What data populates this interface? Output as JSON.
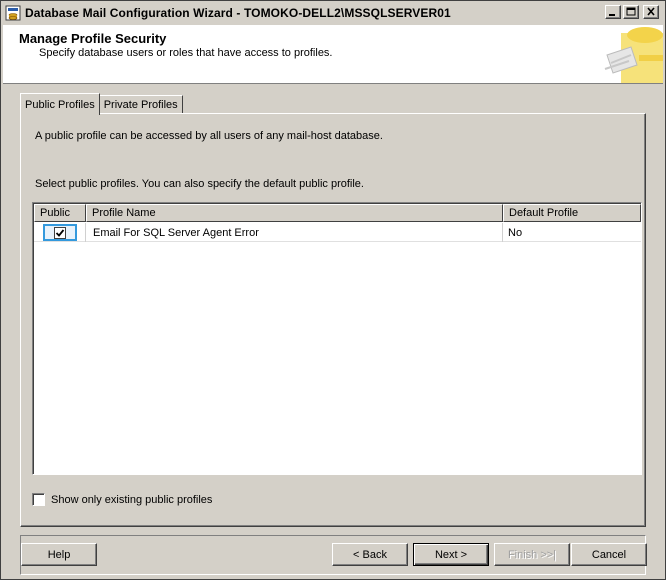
{
  "window": {
    "title": "Database Mail Configuration Wizard - TOMOKO-DELL2\\MSSQLSERVER01"
  },
  "header": {
    "title": "Manage Profile Security",
    "subtitle": "Specify database users or roles that have access to profiles."
  },
  "tabs": [
    {
      "label": "Public Profiles",
      "active": true
    },
    {
      "label": "Private Profiles",
      "active": false
    }
  ],
  "panel": {
    "description": "A public profile can be accessed by all users of any mail-host database.",
    "instruction": "Select public profiles. You can also specify the default public profile."
  },
  "grid": {
    "columns": [
      "Public",
      "Profile Name",
      "Default Profile"
    ],
    "rows": [
      {
        "public": true,
        "profile_name": "Email For SQL Server Agent Error",
        "default_profile": "No"
      }
    ]
  },
  "show_existing": {
    "label": "Show only existing public profiles",
    "checked": false
  },
  "buttons": {
    "help": "Help",
    "back": "< Back",
    "next": "Next >",
    "finish": "Finish >>|",
    "cancel": "Cancel"
  },
  "colors": {
    "dialog_bg": "#d4d0c8",
    "header_bg": "#ffffff",
    "focus_border": "#3399dd"
  }
}
